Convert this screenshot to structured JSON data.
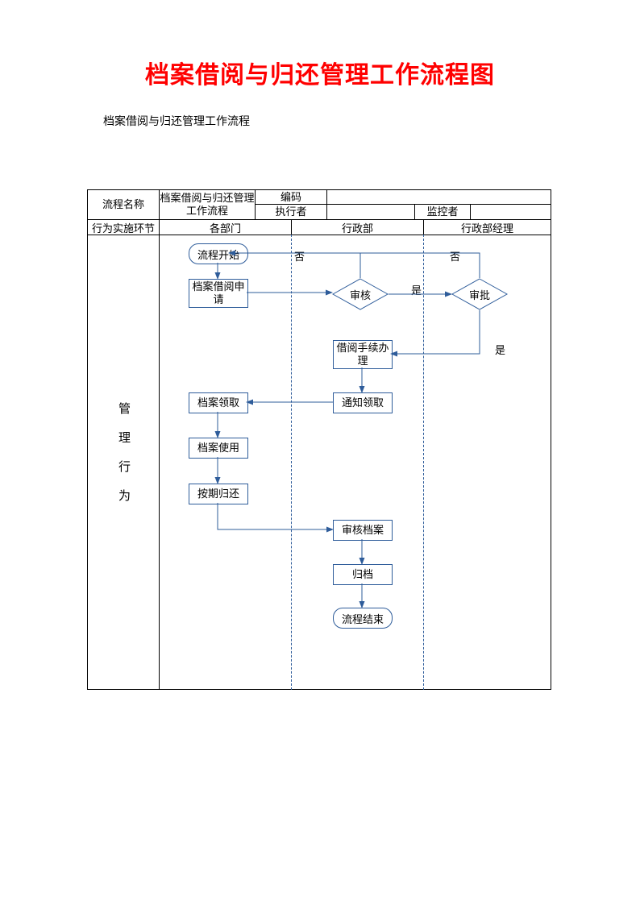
{
  "title": "档案借阅与归还管理工作流程图",
  "subtitle": "档案借阅与归还管理工作流程",
  "header": {
    "name_label": "流程名称",
    "name_value": "档案借阅与归还管理工作流程",
    "code_label": "编码",
    "exec_label": "执行者",
    "mon_label": "监控者",
    "step_label": "行为实施环节"
  },
  "lanes": {
    "dept": "各部门",
    "admin": "行政部",
    "manager": "行政部经理"
  },
  "row_label_lines": [
    "管",
    "理",
    "行",
    "为"
  ],
  "nodes": {
    "start": "流程开始",
    "apply": "档案借阅申请",
    "review": "审核",
    "approve": "审批",
    "procedure": "借阅手续办理",
    "notify": "通知领取",
    "pickup": "档案领取",
    "use": "档案使用",
    "return": "按期归还",
    "check": "审核档案",
    "file": "归档",
    "end": "流程结束"
  },
  "labels": {
    "yes": "是",
    "no": "否"
  }
}
